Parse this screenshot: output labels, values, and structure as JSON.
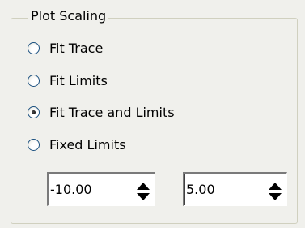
{
  "group": {
    "title": "Plot Scaling"
  },
  "options": [
    {
      "label": "Fit Trace",
      "checked": false
    },
    {
      "label": "Fit Limits",
      "checked": false
    },
    {
      "label": "Fit Trace and Limits",
      "checked": true
    },
    {
      "label": "Fixed Limits",
      "checked": false
    }
  ],
  "limits": {
    "lower_value": "-10.00",
    "upper_value": "5.00"
  }
}
